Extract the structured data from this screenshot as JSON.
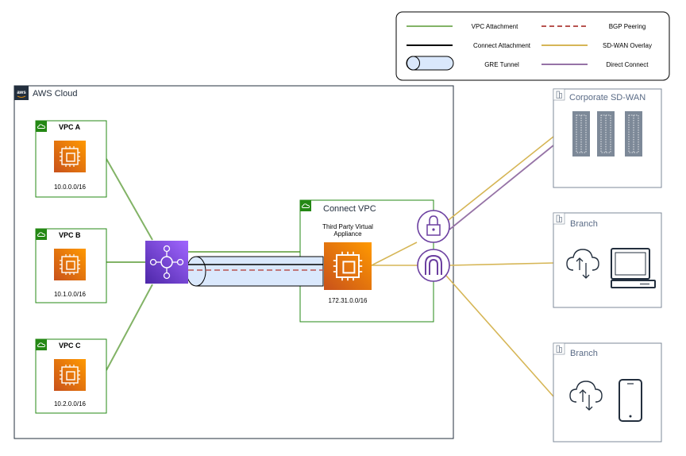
{
  "legend": {
    "vpc_attachment": "VPC Attachment",
    "bgp_peering": "BGP Peering",
    "connect_attachment": "Connect Attachment",
    "sdwan_overlay": "SD-WAN Overlay",
    "gre_tunnel": "GRE Tunnel",
    "direct_connect": "Direct Connect"
  },
  "aws_cloud": {
    "logo_text": "aws",
    "label": "AWS Cloud"
  },
  "vpcs": [
    {
      "name": "VPC A",
      "cidr": "10.0.0.0/16"
    },
    {
      "name": "VPC B",
      "cidr": "10.1.0.0/16"
    },
    {
      "name": "VPC C",
      "cidr": "10.2.0.0/16"
    }
  ],
  "connect_vpc": {
    "label": "Connect VPC",
    "appliance_line1": "Third Party Virtual",
    "appliance_line2": "Appliance",
    "cidr": "172.31.0.0/16"
  },
  "sites": {
    "corporate": "Corporate SD-WAN",
    "branch1": "Branch",
    "branch2": "Branch"
  },
  "colors": {
    "vpc_attachment": "#82b366",
    "bgp_peering": "#b85450",
    "sdwan_overlay": "#d6b656",
    "direct_connect": "#9673a6",
    "vpc_green": "#248814",
    "ec2_orange": "#ed7100",
    "tgw_purple": "#7c3aed",
    "gateway_purple": "#6b3fa0",
    "gre_fill": "#dae8fc"
  },
  "icons": [
    "vpc-cloud-icon",
    "ec2-instance-icon",
    "transit-gateway-icon",
    "vpn-gateway-lock-icon",
    "direct-connect-gateway-icon",
    "building-icon",
    "cloud-upload-download-icon",
    "laptop-icon",
    "mobile-phone-icon",
    "aws-logo-icon"
  ]
}
